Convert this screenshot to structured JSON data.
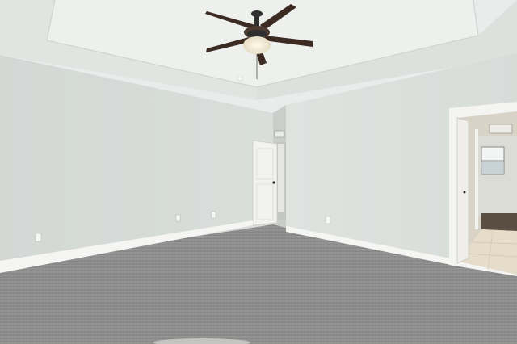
{
  "scene": {
    "description_free": true,
    "colors": {
      "wall_left": "#d5dad7",
      "wall_right": "#dde2df",
      "ceiling": "#e9ecea",
      "tray": "#e2e6e3",
      "carpet": "#8d8d8c",
      "trim": "#f6f6f4",
      "door": "#f1f1ee",
      "hall_floor": "#e4d9c6",
      "fan_wood": "#3a2c25",
      "fan_metal": "#2f2f2f",
      "light_glow": "#fff4d8"
    }
  }
}
